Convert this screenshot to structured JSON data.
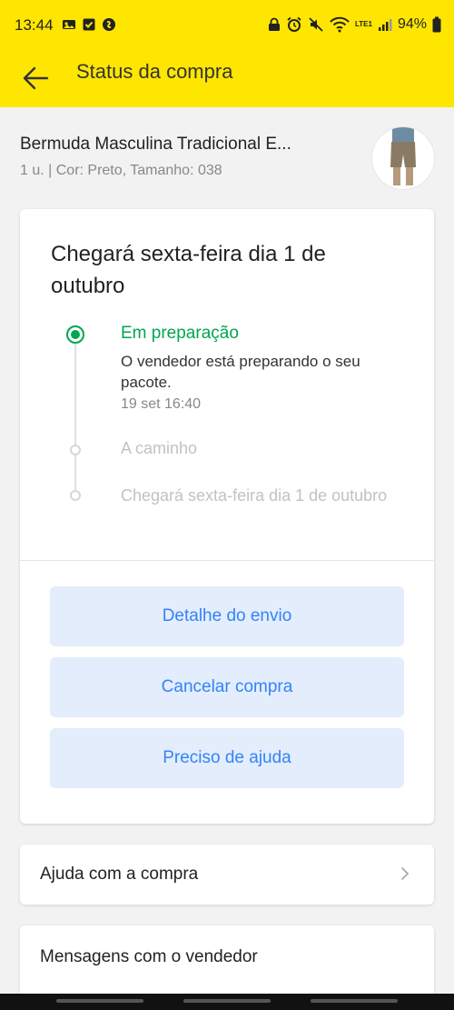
{
  "status_bar": {
    "time": "13:44",
    "battery": "94%",
    "network_label": "LTE1"
  },
  "app_bar": {
    "title": "Status da compra"
  },
  "product": {
    "name": "Bermuda Masculina Tradicional E...",
    "meta": "1 u. | Cor: Preto, Tamanho: 038"
  },
  "status_card": {
    "headline": "Chegará sexta-feira dia 1 de outubro",
    "steps": [
      {
        "title": "Em preparação",
        "description": "O vendedor está preparando o seu pacote.",
        "time": "19 set 16:40"
      },
      {
        "title": "A caminho"
      },
      {
        "title": "Chegará sexta-feira dia 1 de outubro"
      }
    ],
    "actions": {
      "shipping_detail": "Detalhe do envio",
      "cancel_purchase": "Cancelar compra",
      "need_help": "Preciso de ajuda"
    }
  },
  "help_row": {
    "label": "Ajuda com a compra"
  },
  "messages_row": {
    "label": "Mensagens com o vendedor"
  },
  "colors": {
    "brand_yellow": "#ffe600",
    "success_green": "#00a650",
    "action_blue": "#3483fa",
    "action_bg": "#e3edfb"
  }
}
